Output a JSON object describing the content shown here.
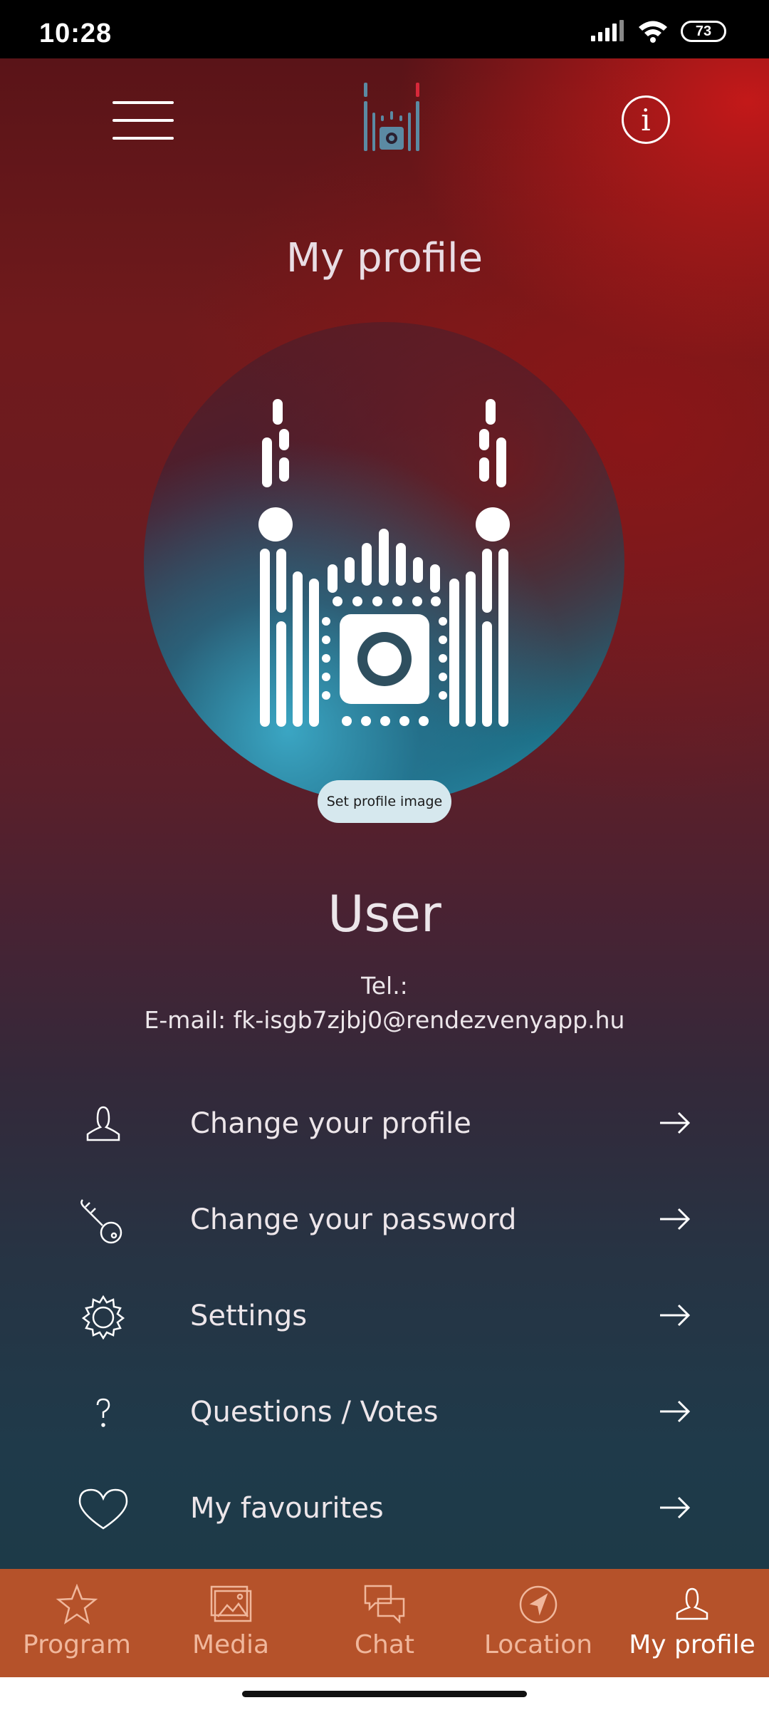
{
  "status_bar": {
    "time": "10:28",
    "battery": "73"
  },
  "header": {
    "title": "My profile"
  },
  "avatar": {
    "set_image_label": "Set profile image"
  },
  "user": {
    "name": "User",
    "tel_line": "Tel.:",
    "email_line": "E-mail: fk-isgb7zjbj0@rendezvenyapp.hu"
  },
  "menu": [
    {
      "label": "Change your profile",
      "icon": "person-icon"
    },
    {
      "label": "Change your password",
      "icon": "key-icon"
    },
    {
      "label": "Settings",
      "icon": "gear-icon"
    },
    {
      "label": "Questions / Votes",
      "icon": "question-icon"
    },
    {
      "label": "My favourites",
      "icon": "heart-icon"
    }
  ],
  "bottom_nav": [
    {
      "label": "Program",
      "icon": "star-icon",
      "active": false
    },
    {
      "label": "Media",
      "icon": "images-icon",
      "active": false
    },
    {
      "label": "Chat",
      "icon": "chat-icon",
      "active": false
    },
    {
      "label": "Location",
      "icon": "navigation-icon",
      "active": false
    },
    {
      "label": "My profile",
      "icon": "person-icon",
      "active": true
    }
  ],
  "colors": {
    "nav_background": "#b5522a",
    "nav_label_inactive": "#f0b79c",
    "nav_label_active": "#ffffff",
    "avatar_button_bg": "#d6e8ee"
  }
}
